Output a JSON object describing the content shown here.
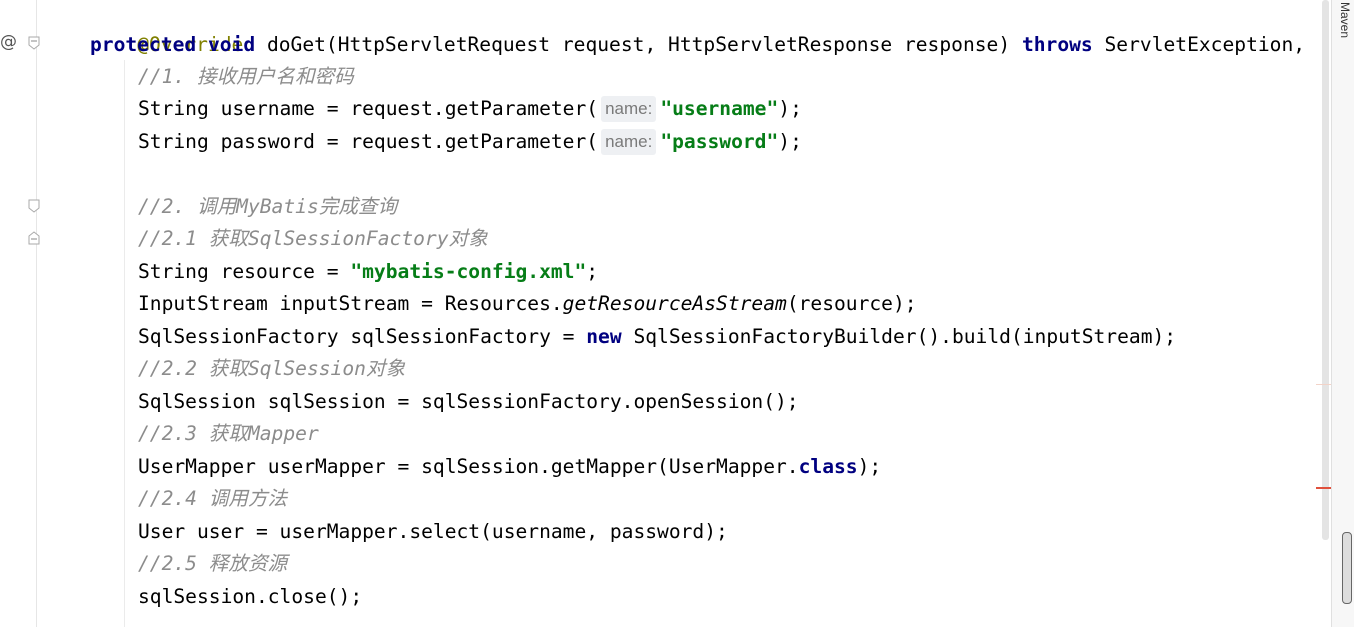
{
  "gutter": {
    "annotation_icon": "@"
  },
  "right_tool_window": {
    "label": "Maven"
  },
  "code": {
    "l0_override": "@Override",
    "l1_protected": "protected",
    "l1_void": "void",
    "l1_rest": "doGet(HttpServletRequest request, HttpServletResponse response)",
    "l1_throws": "throws",
    "l1_tail": "ServletException,",
    "l2_comment": "//1. 接收用户名和密码",
    "l3_pre": "String username = request.getParameter(",
    "l3_hint": "name:",
    "l3_str": "\"username\"",
    "l3_post": ");",
    "l4_pre": "String password = request.getParameter(",
    "l4_hint": "name:",
    "l4_str": "\"password\"",
    "l4_post": ");",
    "l6_comment": "//2. 调用MyBatis完成查询",
    "l7_comment": "//2.1 获取SqlSessionFactory对象",
    "l8_pre": "String resource = ",
    "l8_str": "\"mybatis-config.xml\"",
    "l8_post": ";",
    "l9_pre": "InputStream inputStream = Resources.",
    "l9_ital": "getResourceAsStream",
    "l9_post": "(resource);",
    "l10_pre": "SqlSessionFactory sqlSessionFactory = ",
    "l10_new": "new",
    "l10_post": " SqlSessionFactoryBuilder().build(inputStream);",
    "l11_comment": "//2.2 获取SqlSession对象",
    "l12": "SqlSession sqlSession = sqlSessionFactory.openSession();",
    "l13_comment": "//2.3 获取Mapper",
    "l14_pre": "UserMapper userMapper = sqlSession.getMapper(UserMapper.",
    "l14_class": "class",
    "l14_post": ");",
    "l15_comment": "//2.4 调用方法",
    "l16": "User user = userMapper.select(username, password);",
    "l17_comment": "//2.5 释放资源",
    "l18": "sqlSession.close();"
  },
  "colors": {
    "keyword": "#000080",
    "annotation": "#808000",
    "string": "#067d17",
    "comment": "#8c8c8c"
  }
}
